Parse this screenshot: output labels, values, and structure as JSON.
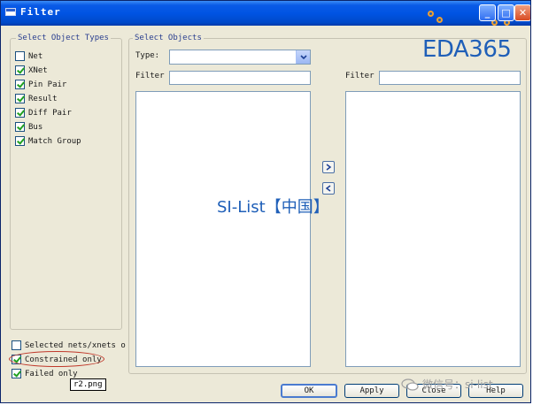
{
  "window": {
    "title": "Filter",
    "controls": {
      "minimize": "_",
      "maximize": "□",
      "close": "✕"
    }
  },
  "watermarks": {
    "brand": "EDA365",
    "center": "SI-List【中国】",
    "bottom": "微信号：si-list"
  },
  "object_types": {
    "legend": "Select Object Types",
    "items": [
      {
        "label": "Net",
        "checked": false
      },
      {
        "label": "XNet",
        "checked": true
      },
      {
        "label": "Pin Pair",
        "checked": true
      },
      {
        "label": "Result",
        "checked": true
      },
      {
        "label": "Diff Pair",
        "checked": true
      },
      {
        "label": "Bus",
        "checked": true
      },
      {
        "label": "Match Group",
        "checked": true
      }
    ]
  },
  "bottom_options": [
    {
      "label": "Selected nets/xnets o",
      "checked": false
    },
    {
      "label": "Constrained only",
      "checked": true
    },
    {
      "label": "Failed only",
      "checked": true
    }
  ],
  "select_objects": {
    "legend": "Select Objects",
    "type_label": "Type:",
    "type_value": "",
    "left_filter_label": "Filter",
    "left_filter_value": "",
    "right_filter_label": "Filter",
    "right_filter_value": ""
  },
  "arrows": {
    "move_right": "right-arrow-icon",
    "move_left": "left-arrow-icon"
  },
  "tooltip": "r2.png",
  "buttons": {
    "ok": "OK",
    "apply": "Apply",
    "close": "Close",
    "help": "Help"
  },
  "colors": {
    "titlebar": "#0054E3",
    "dialog_bg": "#ECE9D8",
    "legend_text": "#2a3f8f",
    "watermark": "#1f5fb8",
    "highlight": "#c0392b"
  }
}
